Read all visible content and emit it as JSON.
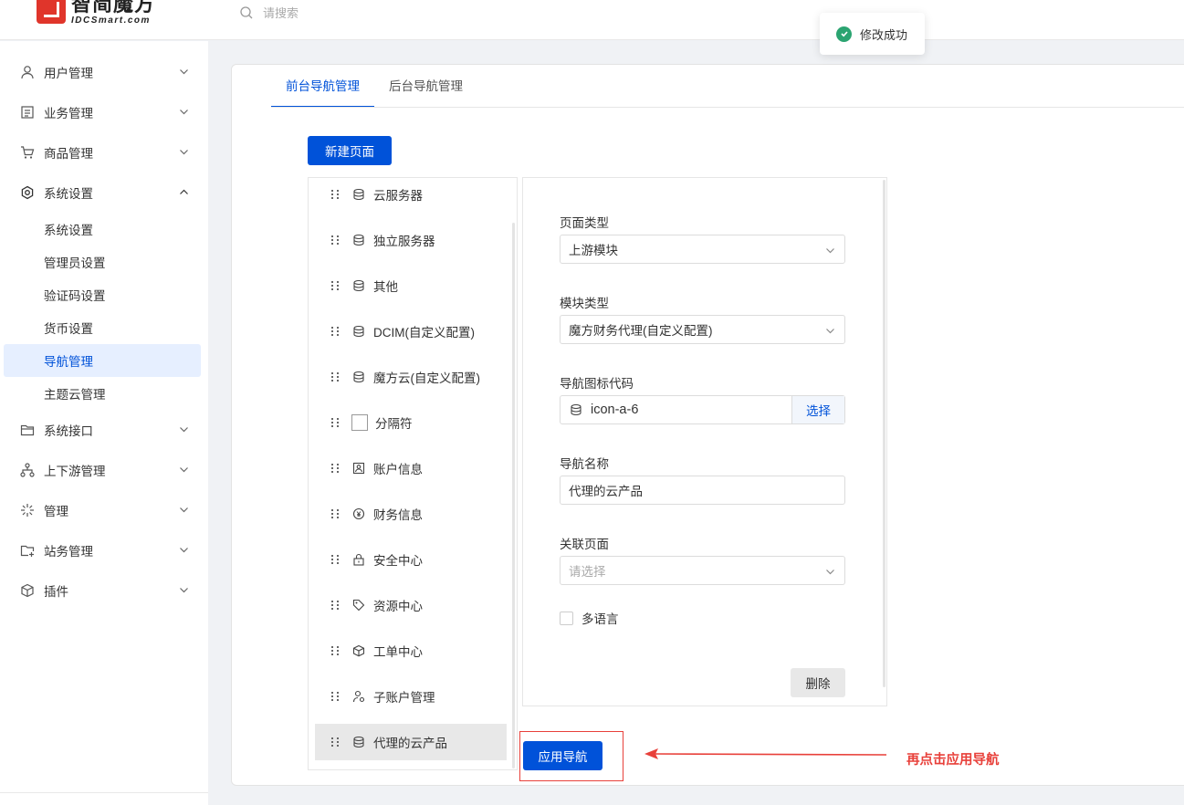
{
  "header": {
    "logo_cn": "智简魔方",
    "logo_en": "IDCSmart.com",
    "search_placeholder": "请搜索",
    "toast": "修改成功"
  },
  "sidebar": {
    "items": [
      {
        "label": "用户管理",
        "icon": "user-icon"
      },
      {
        "label": "业务管理",
        "icon": "document-icon"
      },
      {
        "label": "商品管理",
        "icon": "cart-icon"
      },
      {
        "label": "系统设置",
        "icon": "settings-icon",
        "expanded": true
      },
      {
        "label": "系统接口",
        "icon": "folder-icon"
      },
      {
        "label": "上下游管理",
        "icon": "hierarchy-icon"
      },
      {
        "label": "管理",
        "icon": "sparkle-icon"
      },
      {
        "label": "站务管理",
        "icon": "folder-add-icon"
      },
      {
        "label": "插件",
        "icon": "cube-icon"
      }
    ],
    "sub_items": [
      "系统设置",
      "管理员设置",
      "验证码设置",
      "货币设置",
      "导航管理",
      "主题云管理"
    ],
    "active_sub": "导航管理"
  },
  "tabs": [
    "前台导航管理",
    "后台导航管理"
  ],
  "new_page_button": "新建页面",
  "nav_items": [
    {
      "label": "云服务器",
      "icon": "database-icon"
    },
    {
      "label": "独立服务器",
      "icon": "database-icon"
    },
    {
      "label": "其他",
      "icon": "database-icon"
    },
    {
      "label": "DCIM(自定义配置)",
      "icon": "database-icon"
    },
    {
      "label": "魔方云(自定义配置)",
      "icon": "database-icon"
    },
    {
      "label": "分隔符",
      "icon": "separator-box-icon"
    },
    {
      "label": "账户信息",
      "icon": "id-card-icon"
    },
    {
      "label": "财务信息",
      "icon": "yuan-icon"
    },
    {
      "label": "安全中心",
      "icon": "lock-icon"
    },
    {
      "label": "资源中心",
      "icon": "tag-icon"
    },
    {
      "label": "工单中心",
      "icon": "box-icon"
    },
    {
      "label": "子账户管理",
      "icon": "sub-user-icon"
    },
    {
      "label": "代理的云产品",
      "icon": "database-icon",
      "selected": true
    }
  ],
  "form": {
    "page_type_label": "页面类型",
    "page_type_value": "上游模块",
    "module_type_label": "模块类型",
    "module_type_value": "魔方财务代理(自定义配置)",
    "icon_code_label": "导航图标代码",
    "icon_code_value": "icon-a-6",
    "icon_select_button": "选择",
    "nav_name_label": "导航名称",
    "nav_name_value": "代理的云产品",
    "related_page_label": "关联页面",
    "related_page_placeholder": "请选择",
    "multi_lang_label": "多语言",
    "delete_button": "删除"
  },
  "apply_button": "应用导航",
  "annotation": "再点击应用导航",
  "colors": {
    "primary": "#0052d9",
    "annotation": "#e8403a",
    "success": "#2ba471",
    "logo": "#e0352b"
  }
}
